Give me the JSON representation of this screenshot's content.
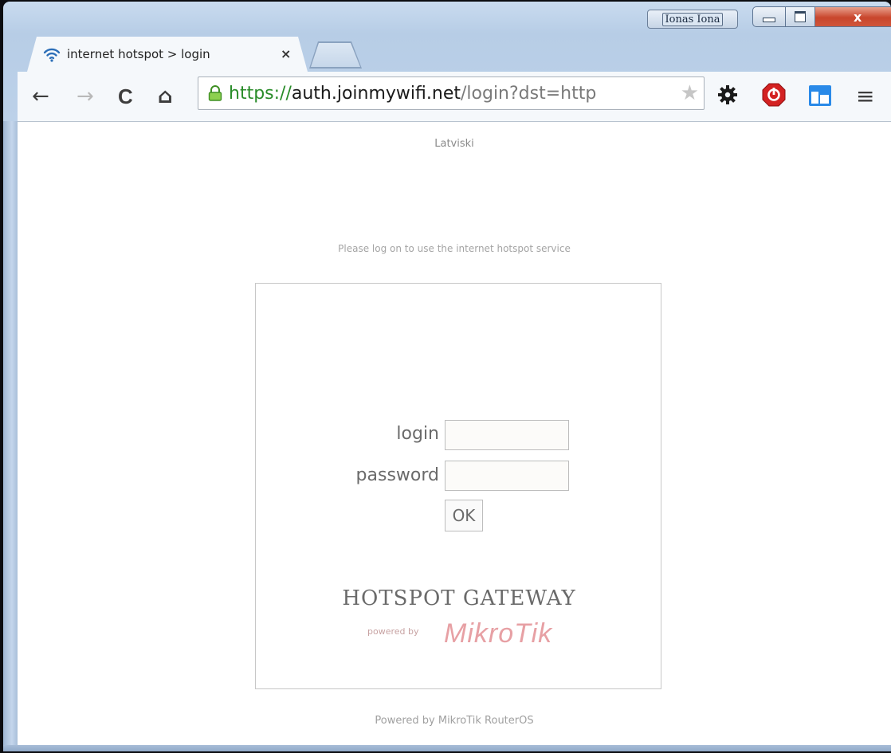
{
  "window": {
    "user_button": "Ionas Iona",
    "close_symbol": "x"
  },
  "tab": {
    "title": "internet hotspot > login",
    "close": "×",
    "icon": "wifi-icon"
  },
  "toolbar": {
    "back": "←",
    "forward": "→",
    "reload": "C",
    "home": "⌂",
    "url_scheme": "https://",
    "url_host": "auth.joinmywifi.net",
    "url_path": "/login?dst=http",
    "star": "★",
    "menu": "≡"
  },
  "page": {
    "language_link": "Latviski",
    "notice": "Please log on to use the internet hotspot service",
    "login_label": "login",
    "password_label": "password",
    "ok_button": "OK",
    "brand_title": "HOTSPOT GATEWAY",
    "powered_by_small": "powered by",
    "mikrotik_logo": "MikroTik",
    "footer": "Powered by MikroTik RouterOS"
  }
}
